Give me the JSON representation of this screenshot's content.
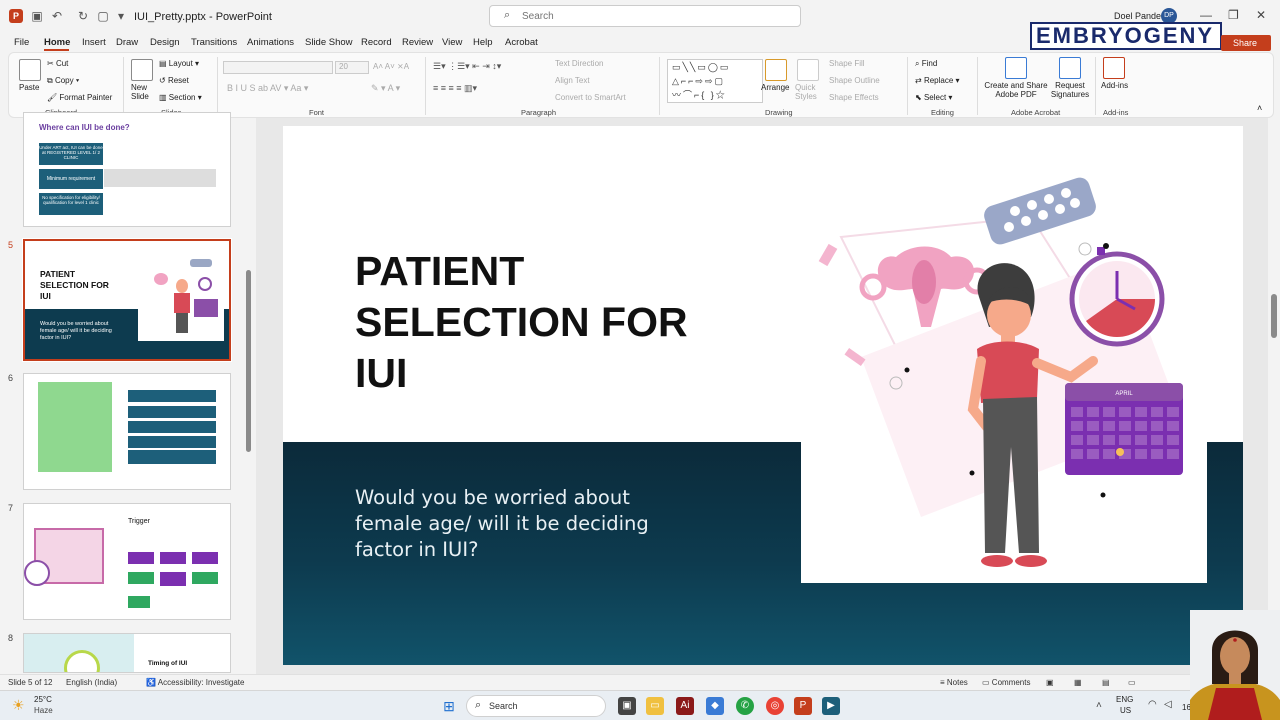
{
  "titlebar": {
    "filename": "IUI_Pretty.pptx",
    "app": "PowerPoint",
    "search_placeholder": "Search",
    "user": "Doel Pande",
    "user_initials": "DP"
  },
  "menu": [
    "File",
    "Home",
    "Insert",
    "Draw",
    "Design",
    "Transitions",
    "Animations",
    "Slide Show",
    "Record",
    "Review",
    "View",
    "Help",
    "Acrobat"
  ],
  "brand": {
    "watermark": "EMBRYOGENY",
    "share": "Share"
  },
  "ribbon": {
    "clipboard": {
      "paste": "Paste",
      "cut": "Cut",
      "copy": "Copy",
      "format_painter": "Format Painter",
      "label": "Clipboard"
    },
    "slides": {
      "new_slide": "New Slide",
      "layout": "Layout",
      "reset": "Reset",
      "section": "Section",
      "label": "Slides"
    },
    "font": {
      "size": "20",
      "label": "Font"
    },
    "paragraph": {
      "text_direction": "Text Direction",
      "align_text": "Align Text",
      "convert": "Convert to SmartArt",
      "label": "Paragraph"
    },
    "drawing": {
      "arrange": "Arrange",
      "quick_styles": "Quick Styles",
      "shape_fill": "Shape Fill",
      "shape_outline": "Shape Outline",
      "shape_effects": "Shape Effects",
      "label": "Drawing"
    },
    "editing": {
      "find": "Find",
      "replace": "Replace",
      "select": "Select",
      "label": "Editing"
    },
    "acrobat": {
      "create": "Create and Share Adobe PDF",
      "request": "Request Signatures",
      "label": "Adobe Acrobat"
    },
    "addins": {
      "addins": "Add-ins",
      "label": "Add-ins"
    }
  },
  "thumbnails": [
    {
      "num": "",
      "title": "Where can IUI be done?",
      "b1": "Under ART act, IUI can be done at REGISTERED LEVEL 1/ 2 CLINIC",
      "b2": "Minimum requirement",
      "b3": "No specification for eligibility/ qualification for level 1 clinic"
    },
    {
      "num": "5",
      "title": "PATIENT SELECTION FOR IUI",
      "sub": "Would you be worried about female age/ will it be deciding factor in IUI?"
    },
    {
      "num": "6"
    },
    {
      "num": "7",
      "title": "Trigger"
    },
    {
      "num": "8",
      "title": "Timing of IUI"
    }
  ],
  "slide": {
    "title": "PATIENT SELECTION FOR IUI",
    "subtitle": "Would you be worried about female age/ will it be deciding factor in IUI?",
    "calendar_month": "APRIL"
  },
  "status": {
    "slide_of": "Slide 5 of 12",
    "language": "English (India)",
    "accessibility": "Accessibility: Investigate",
    "notes": "Notes",
    "comments": "Comments"
  },
  "taskbar": {
    "weather_temp": "25°C",
    "weather_desc": "Haze",
    "search": "Search",
    "lang1": "ENG",
    "lang2": "US",
    "time": "16"
  }
}
